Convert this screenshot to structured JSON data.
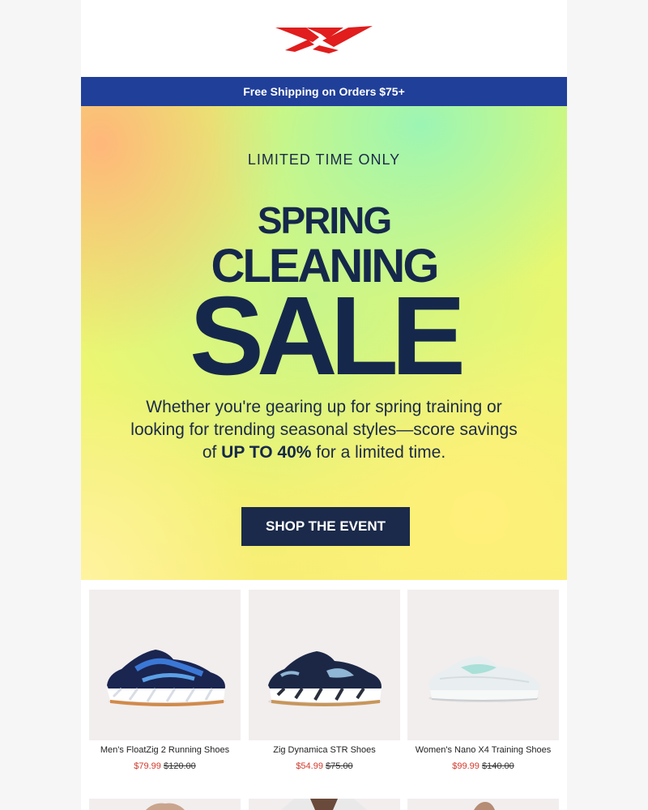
{
  "brand": {
    "logo_icon": "reebok-delta-logo-icon",
    "logo_color": "#e11d1d"
  },
  "shipping_bar": {
    "text": "Free Shipping on Orders $75+",
    "bg": "#203f99"
  },
  "hero": {
    "kicker": "LIMITED TIME ONLY",
    "line1": "SPRING",
    "line2": "CLEANING",
    "line3": "SALE",
    "body_part1": "Whether you're gearing up for spring training or looking for trending seasonal styles—score savings of ",
    "body_highlight": "UP TO 40%",
    "body_part2": " for a limited time.",
    "cta_label": "SHOP THE EVENT",
    "text_color": "#15284b"
  },
  "products": [
    {
      "name": "Men's FloatZig 2 Running Shoes",
      "sale_price": "$79.99",
      "original_price": "$120.00",
      "image_icon": "blue-running-shoe-icon"
    },
    {
      "name": "Zig Dynamica STR Shoes",
      "sale_price": "$54.99",
      "original_price": "$75.00",
      "image_icon": "navy-sneaker-icon"
    },
    {
      "name": "Women's Nano X4 Training Shoes",
      "sale_price": "$99.99",
      "original_price": "$140.00",
      "image_icon": "white-training-shoe-icon"
    }
  ],
  "colors": {
    "sale_price": "#d03a2c",
    "cta_bg": "#1b2a4a"
  }
}
